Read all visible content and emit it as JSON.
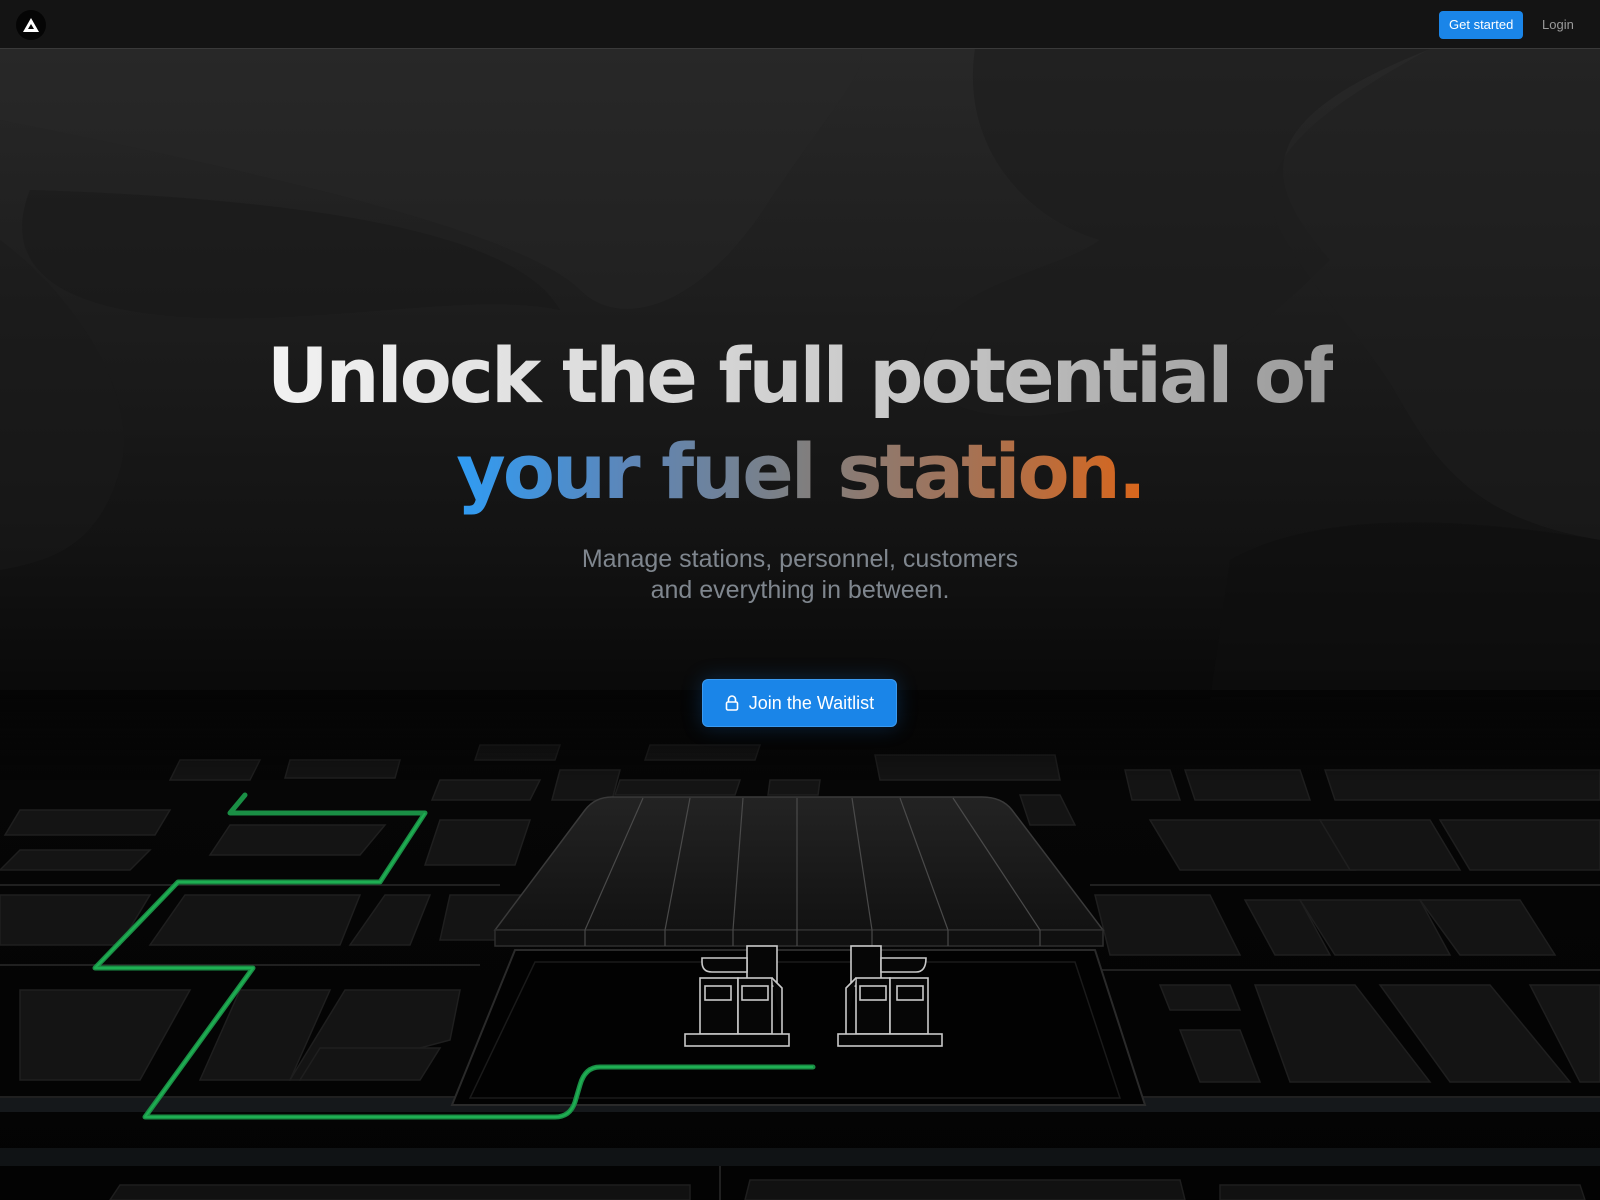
{
  "navbar": {
    "logo_icon": "triangle-logo-icon",
    "get_started_label": "Get started",
    "login_label": "Login"
  },
  "hero": {
    "title_line1": "Unlock the full potential of",
    "title_line2": "your fuel station.",
    "subtitle_line1": "Manage stations, personnel, customers",
    "subtitle_line2": "and everything in between.",
    "cta_label": "Join the Waitlist",
    "cta_icon": "lock-icon"
  },
  "colors": {
    "accent_blue": "#1a85e8",
    "route_green": "#1db954",
    "title_blue": "#2f9cf4",
    "title_orange": "#d9661b"
  }
}
